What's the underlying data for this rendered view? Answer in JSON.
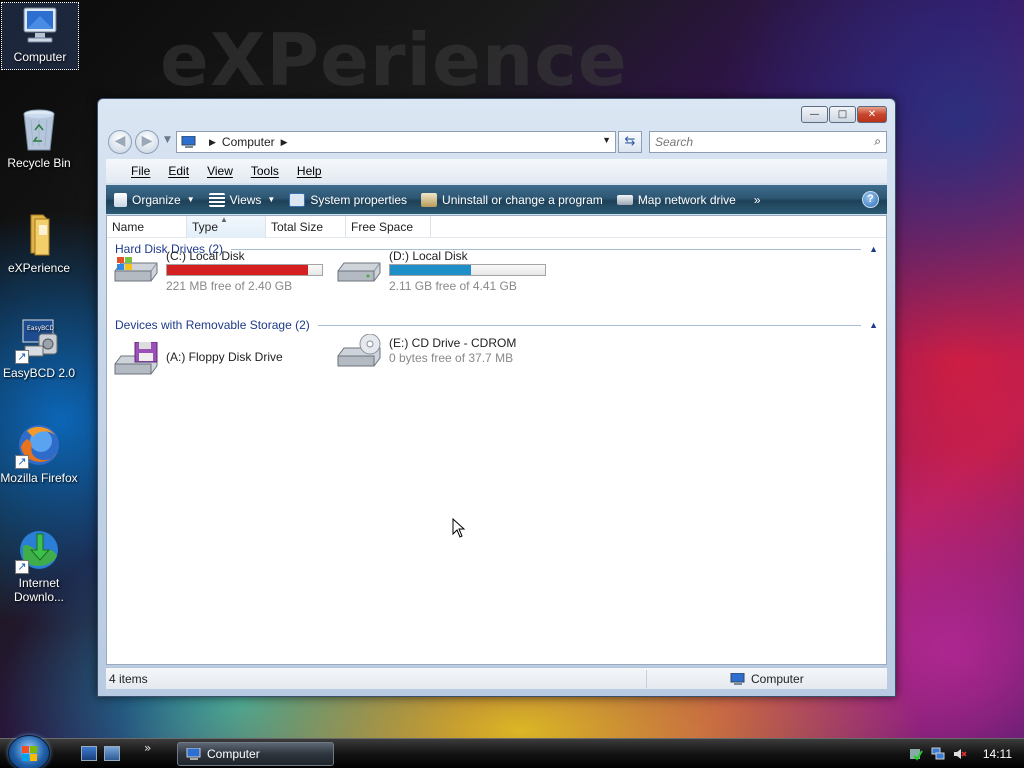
{
  "desktop": {
    "watermark": "eXPerience",
    "icons": [
      {
        "label": "Computer",
        "icon": "computer-icon"
      },
      {
        "label": "Recycle Bin",
        "icon": "recycle-bin-icon"
      },
      {
        "label": "eXPerience",
        "icon": "folder-icon"
      },
      {
        "label": "EasyBCD 2.0",
        "icon": "easybcd-icon"
      },
      {
        "label": "Mozilla Firefox",
        "icon": "firefox-icon"
      },
      {
        "label": "Internet Downlo...",
        "icon": "idm-icon"
      }
    ]
  },
  "window": {
    "controls": {
      "minimize": "—",
      "maximize": "□",
      "close": "✕"
    },
    "address": {
      "location": "Computer"
    },
    "search": {
      "placeholder": "Search"
    },
    "menu": [
      "File",
      "Edit",
      "View",
      "Tools",
      "Help"
    ],
    "commands": [
      {
        "label": "Organize",
        "icon": "organize-icon",
        "has_dropdown": true
      },
      {
        "label": "Views",
        "icon": "views-icon",
        "has_dropdown": true
      },
      {
        "label": "System properties",
        "icon": "system-properties-icon",
        "has_dropdown": false
      },
      {
        "label": "Uninstall or change a program",
        "icon": "uninstall-icon",
        "has_dropdown": false
      },
      {
        "label": "Map network drive",
        "icon": "map-network-drive-icon",
        "has_dropdown": false
      }
    ],
    "more_chevron": "»",
    "help": "?",
    "columns": [
      "Name",
      "Type",
      "Total Size",
      "Free Space"
    ],
    "groups": [
      {
        "title": "Hard Disk Drives (2)",
        "items": [
          {
            "name": "(C:) Local Disk",
            "free_text": "221 MB free of 2.40 GB",
            "used_fraction": 0.91,
            "bar_color": "#d42020",
            "icon": "windows-drive-icon"
          },
          {
            "name": "(D:) Local Disk",
            "free_text": "2.11 GB free of 4.41 GB",
            "used_fraction": 0.52,
            "bar_color": "#1f8fc8",
            "icon": "hard-drive-icon"
          }
        ]
      },
      {
        "title": "Devices with Removable Storage (2)",
        "items": [
          {
            "name": "(A:) Floppy Disk Drive",
            "free_text": "",
            "icon": "floppy-drive-icon"
          },
          {
            "name": "(E:) CD Drive - CDROM",
            "free_text": "0 bytes free of 37.7 MB",
            "icon": "cd-drive-icon"
          }
        ]
      }
    ],
    "status": {
      "count": "4 items",
      "location": "Computer"
    }
  },
  "taskbar": {
    "task": "Computer",
    "chevron": "»",
    "clock": "14:11"
  }
}
